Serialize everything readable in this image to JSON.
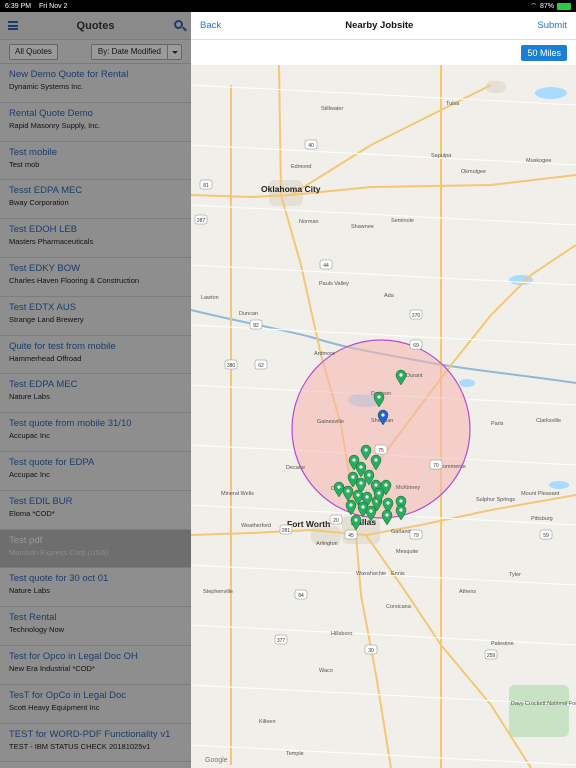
{
  "status_bar": {
    "time": "6:39 PM",
    "date": "Fri Nov 2",
    "battery": "87%"
  },
  "left_pane": {
    "title": "Quotes",
    "filter_label": "All Quotes",
    "sort_label": "By: Date Modified",
    "items": [
      {
        "title": "New Demo Quote for Rental",
        "subtitle": "Dynamic Systems Inc."
      },
      {
        "title": "Rental Quote Demo",
        "subtitle": "Rapid Masonry Supply, Inc."
      },
      {
        "title": "Test mobile",
        "subtitle": "Test mob"
      },
      {
        "title": "Tesst EDPA MEC",
        "subtitle": "Bway Corporation"
      },
      {
        "title": "Test EDOH LEB",
        "subtitle": "Masters Pharmaceuticals"
      },
      {
        "title": "Test EDKY BOW",
        "subtitle": "Charles Haven Flooring & Construction"
      },
      {
        "title": "Test EDTX AUS",
        "subtitle": "Strange Land Brewery"
      },
      {
        "title": "Quite for test from mobile",
        "subtitle": "Hammerhead Offroad"
      },
      {
        "title": "Test EDPA MEC",
        "subtitle": "Nature Labs"
      },
      {
        "title": "Test quote from mobile 31/10",
        "subtitle": "Accupac Inc"
      },
      {
        "title": "Test quote for EDPA",
        "subtitle": "Accupac Inc"
      },
      {
        "title": "Test EDIL BUR",
        "subtitle": "Eloma *COD*"
      },
      {
        "title": "Test pdf",
        "subtitle": "Morrison Express Corp (USA)"
      },
      {
        "title": "Test quote for 30 oct 01",
        "subtitle": "Nature Labs"
      },
      {
        "title": "Test Rental",
        "subtitle": "Technology Now"
      },
      {
        "title": "Test for Opco in Legal Doc OH",
        "subtitle": "New Era Industrial *COD*"
      },
      {
        "title": "TesT for OpCo in Legal Doc",
        "subtitle": "Scott Heavy Equipment Inc"
      },
      {
        "title": "TEST for WORD-PDF Functionality v1",
        "subtitle": "TEST - IBM STATUS CHECK 20181025v1"
      }
    ]
  },
  "right_pane": {
    "back_label": "Back",
    "title": "Nearby Jobsite",
    "submit_label": "Submit",
    "radius_label": "50 Miles"
  },
  "map": {
    "cities_major": [
      "Oklahoma City",
      "Fort Worth",
      "Dallas"
    ],
    "cities": [
      "Tulsa",
      "Stillwater",
      "Edmond",
      "Norman",
      "Shawnee",
      "Sapulpa",
      "Okmulgee",
      "Ada",
      "Seminole",
      "Lawton",
      "Duncan",
      "Ardmore",
      "Durant",
      "Denison",
      "Sherman",
      "Gainesville",
      "Denton",
      "Decatur",
      "McKinney",
      "Arlington",
      "Weatherford",
      "Garland",
      "Mesquite",
      "Sulphur Springs",
      "Commerce",
      "Paris",
      "Clarksville",
      "Mount Pleasant",
      "Pittsburg",
      "Tyler",
      "Corsicana",
      "Ennis",
      "Waxahachie",
      "Waco",
      "Killeen",
      "Temple",
      "Stephenville",
      "Athens",
      "Palestine",
      "Mineral Wells",
      "Hillsboro",
      "Pauls Valley",
      "Muskogee",
      "Davy Crockett National Forest"
    ],
    "labels_extra": [
      "Google"
    ],
    "highway_shields": [
      "35",
      "40",
      "44",
      "69",
      "75",
      "70",
      "82",
      "81",
      "287",
      "281",
      "380",
      "45",
      "20",
      "30",
      "84",
      "79",
      "270",
      "377",
      "259",
      "59",
      "62"
    ],
    "accent_colors": {
      "circle_stroke": "#b64bd6",
      "circle_fill": "#f7c7c4",
      "pin_green": "#27ae60",
      "pin_blue": "#1f63d6"
    }
  }
}
